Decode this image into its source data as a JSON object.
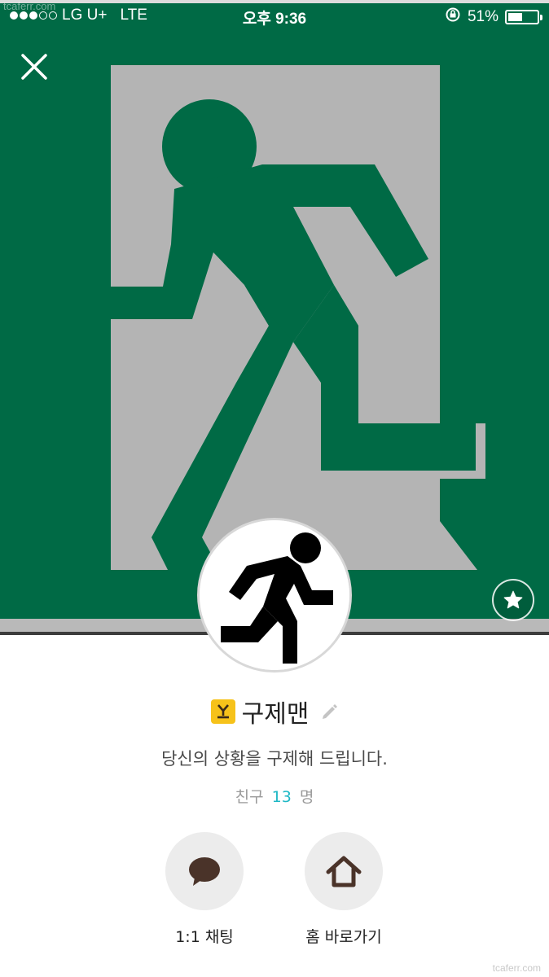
{
  "watermark": {
    "top": "tcaferr.com",
    "bottom": "tcaferr.com"
  },
  "status_bar": {
    "carrier": "LG U+",
    "network": "LTE",
    "time": "오후 9:36",
    "battery_percent_text": "51%",
    "battery_level": 0.51,
    "signal_bars_filled": 3,
    "signal_bars_total": 5
  },
  "header": {
    "close_icon": "close-icon",
    "favorite_icon": "star-icon"
  },
  "profile": {
    "avatar_icon": "running-man-icon",
    "badge_icon": "plus-friend-badge-icon",
    "badge_color": "#f6c21a",
    "name": "구제맨",
    "edit_icon": "pencil-icon",
    "status_message": "당신의 상황을 구제해 드립니다.",
    "friends_label": "친구",
    "friends_count": "13",
    "friends_unit": "명",
    "accent_color": "#1fb8c5"
  },
  "actions": [
    {
      "icon": "speech-bubble-icon",
      "label": "1:1 채팅"
    },
    {
      "icon": "home-icon",
      "label": "홈 바로가기"
    }
  ],
  "colors": {
    "cover_green": "#006a45",
    "cover_gray": "#b4b4b4"
  }
}
